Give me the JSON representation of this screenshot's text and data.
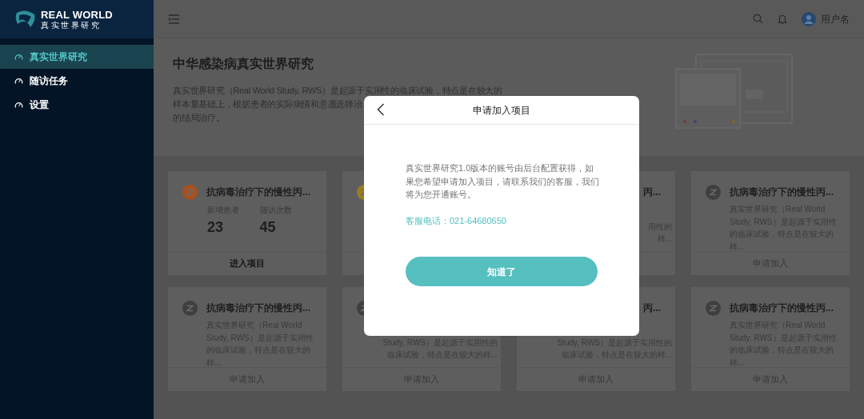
{
  "sidebar": {
    "logo": {
      "title": "REAL WORLD",
      "subtitle": "真实世界研究"
    },
    "items": [
      {
        "label": "真实世界研究",
        "selected": true
      },
      {
        "label": "随访任务",
        "selected": false
      },
      {
        "label": "设置",
        "selected": false
      }
    ]
  },
  "header": {
    "username": "用户名"
  },
  "intro": {
    "title": "中华感染病真实世界研究",
    "lines": [
      "真实世界研究（Real World Study, RWS）是起源于实用性的临床试验，特点是在较大的",
      "样本量基础上，根据患者的实际病情和意愿选择治",
      "的结局治疗。"
    ]
  },
  "cards": [
    {
      "kind": "stats",
      "color": "#a8501f",
      "title": "抗病毒治疗下的慢性丙...",
      "stats": [
        {
          "label": "新增患者",
          "value": "23"
        },
        {
          "label": "随访次数",
          "value": "45"
        }
      ],
      "action": "进入项目"
    },
    {
      "kind": "partial",
      "color": "#9a7d1c"
    },
    {
      "kind": "partial",
      "title": "丙...",
      "fragments": [
        "用性的",
        "样..."
      ]
    },
    {
      "kind": "description",
      "color": "#3f3f3f",
      "title": "抗病毒治疗下的慢性丙...",
      "description": "真实世界研究（Real World Study, RWS）是起源于实用性的临床试验，特点是在较大的样...",
      "action": "申请加入"
    },
    {
      "kind": "description",
      "color": "#3f3f3f",
      "title": "抗病毒治疗下的慢性丙...",
      "description": "真实世界研究（Real World Study, RWS）是起源于实用性的临床试验，特点是在较大的样...",
      "action": "申请加入"
    },
    {
      "kind": "partial",
      "color": "#3f3f3f",
      "fragments": [
        "Study, RWS）是起源于实用性的",
        "临床试验，特点是在较大的样..."
      ],
      "action": "申请加入"
    },
    {
      "kind": "partial",
      "title": "丙...",
      "fragments": [
        "Study, RWS）是起源于实用性的",
        "临床试验，特点是在较大的样..."
      ],
      "action": "申请加入"
    },
    {
      "kind": "description",
      "color": "#3f3f3f",
      "title": "抗病毒治疗下的慢性丙...",
      "description": "真实世界研究（Real World Study, RWS）是起源于实用性的临床试验，特点是在较大的样...",
      "action": "申请加入"
    }
  ],
  "dialog": {
    "title": "申请加入项目",
    "message": "真实世界研究1.0版本的账号由后台配置获得，如果您希望申请加入项目，请联系我们的客服，我们将为您开通账号。",
    "phone": "客服电话：021-64680650",
    "button": "知道了"
  }
}
